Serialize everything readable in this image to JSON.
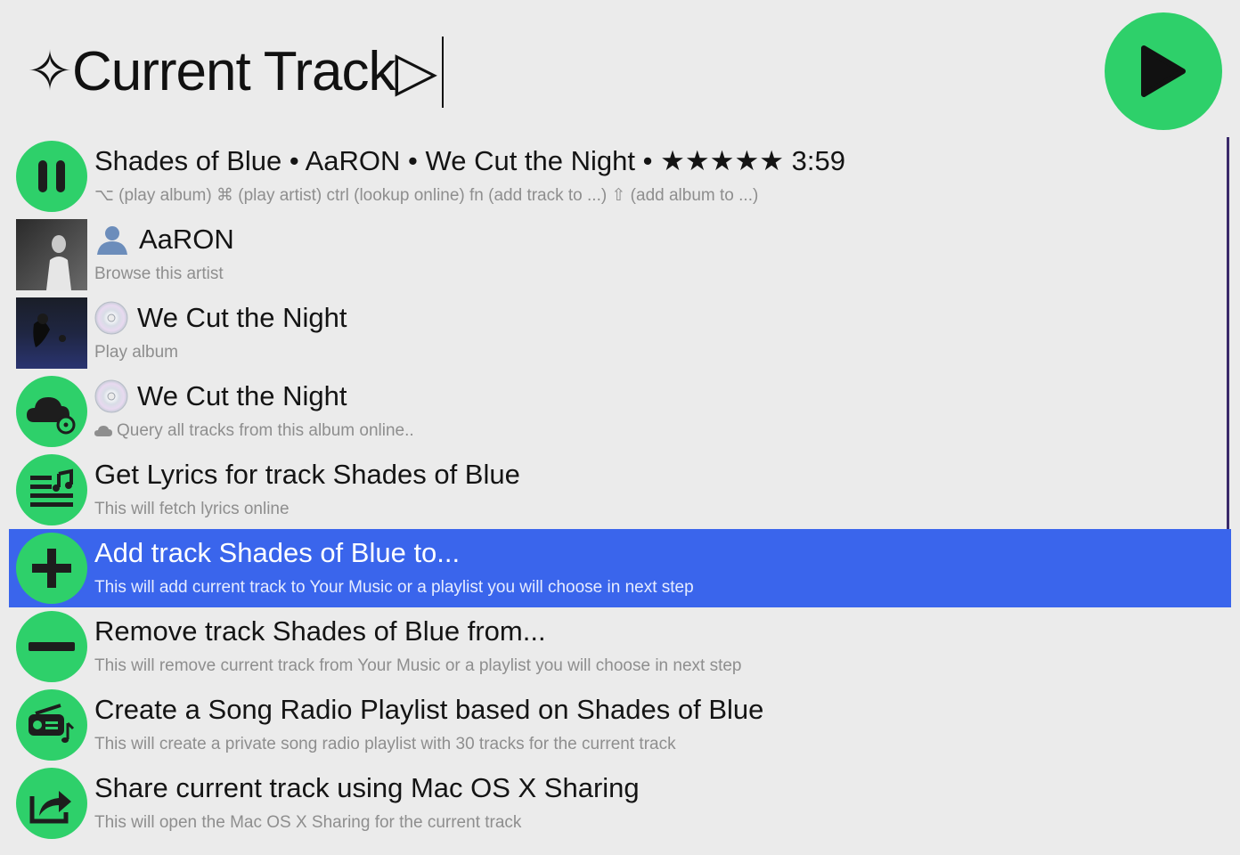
{
  "search": {
    "query": "✧Current Track▷"
  },
  "play_icon": "play-icon",
  "results": [
    {
      "icon": "pause-icon",
      "title": "Shades of Blue • AaRON • We Cut the Night • ★★★★★ 3:59",
      "subtitle": "⌥ (play album) ⌘ (play artist) ctrl (lookup online) fn (add track to ...) ⇧ (add album to ...)"
    },
    {
      "icon": "artist-thumbnail",
      "title_icon": "person-icon",
      "title": "AaRON",
      "subtitle": "Browse this artist"
    },
    {
      "icon": "album-thumbnail",
      "title_icon": "cd-icon",
      "title": "We Cut the Night",
      "subtitle": "Play album"
    },
    {
      "icon": "cloud-icon",
      "title_icon": "cd-icon",
      "title": "We Cut the Night",
      "subtitle_icon": "cloud-icon",
      "subtitle": "Query all tracks from this album online.."
    },
    {
      "icon": "lyrics-icon",
      "title": "Get Lyrics for track Shades of Blue",
      "subtitle": "This will fetch lyrics online"
    },
    {
      "icon": "plus-icon",
      "title": "Add track Shades of Blue to...",
      "subtitle": "This will add current track to Your Music or a playlist you will choose in next step",
      "selected": true
    },
    {
      "icon": "minus-icon",
      "title": "Remove track Shades of Blue from...",
      "subtitle": "This will remove current track from Your Music or a playlist you will choose in next step"
    },
    {
      "icon": "radio-icon",
      "title": "Create a Song Radio Playlist based on Shades of Blue",
      "subtitle": "This will create a private song radio playlist with 30 tracks for the current track"
    },
    {
      "icon": "share-icon",
      "title": "Share current track using Mac OS X Sharing",
      "subtitle": "This will open the Mac OS X Sharing for the current track"
    }
  ],
  "colors": {
    "accent_green": "#2ed06a",
    "selection_blue": "#3a65ec",
    "background": "#ebebeb"
  }
}
